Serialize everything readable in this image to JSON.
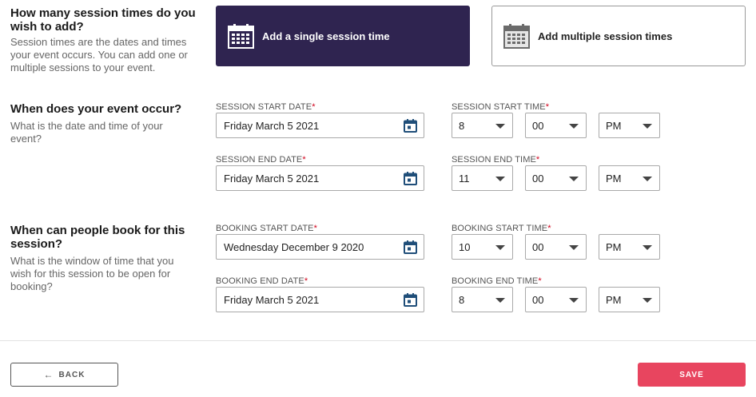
{
  "sections": {
    "how_many": {
      "title": "How many session times do you wish to add?",
      "description": "Session times are the dates and times your event occurs. You can add one or multiple sessions to your event."
    },
    "when_occur": {
      "title": "When does your event occur?",
      "description": "What is the date and time of your event?"
    },
    "when_book": {
      "title": "When can people book for this session?",
      "description": "What is the window of time that you wish for this session to be open for booking?"
    }
  },
  "choices": {
    "single": {
      "label": "Add a single session time",
      "icon": "calendar-icon",
      "selected": true
    },
    "multiple": {
      "label": "Add multiple session times",
      "icon": "calendar-grid-icon",
      "selected": false
    }
  },
  "session": {
    "start_date_label": "SESSION START DATE",
    "start_date": "Friday March 5 2021",
    "start_time_label": "SESSION START TIME",
    "start_hour": "8",
    "start_min": "00",
    "start_ampm": "PM",
    "end_date_label": "SESSION END DATE",
    "end_date": "Friday March 5 2021",
    "end_time_label": "SESSION END TIME",
    "end_hour": "11",
    "end_min": "00",
    "end_ampm": "PM"
  },
  "booking": {
    "start_date_label": "BOOKING START DATE",
    "start_date": "Wednesday December 9 2020",
    "start_time_label": "BOOKING START TIME",
    "start_hour": "10",
    "start_min": "00",
    "start_ampm": "PM",
    "end_date_label": "BOOKING END DATE",
    "end_date": "Friday March 5 2021",
    "end_time_label": "BOOKING END TIME",
    "end_hour": "8",
    "end_min": "00",
    "end_ampm": "PM"
  },
  "required_mark": "*",
  "footer": {
    "back_label": "BACK",
    "save_label": "SAVE"
  },
  "colors": {
    "primary_dark": "#2f2450",
    "save": "#e8455f",
    "icon_blue": "#1f4e79",
    "required": "#d0021b"
  }
}
